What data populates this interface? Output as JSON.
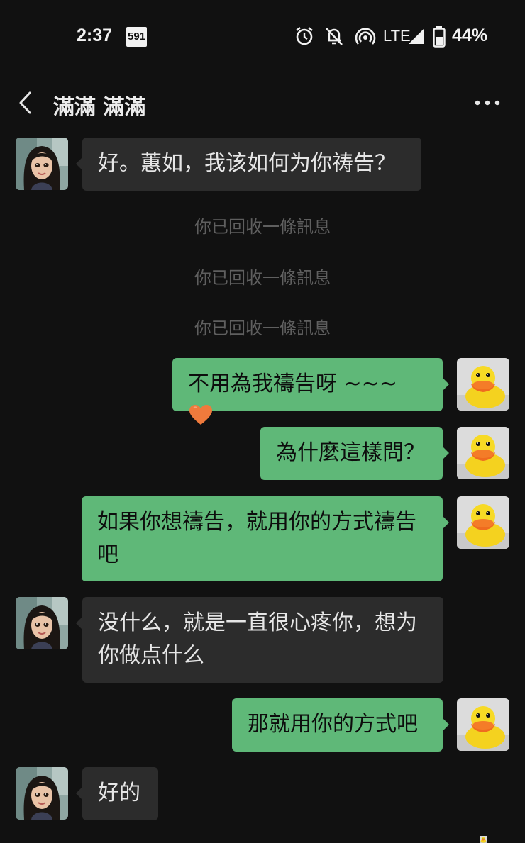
{
  "status_bar": {
    "time": "2:37",
    "badge": "591",
    "network": "LTE",
    "battery": "44%",
    "icons": [
      "alarm-icon",
      "notifications-off-icon",
      "hotspot-icon",
      "signal-icon",
      "battery-icon"
    ]
  },
  "header": {
    "title": "滿滿 滿滿",
    "back_icon": "chevron-left-icon",
    "more_icon": "more-horizontal-icon"
  },
  "messages": [
    {
      "from": "contact",
      "text": "好。蕙如，我该如何为你祷告？"
    },
    {
      "system": "你已回收一條訊息"
    },
    {
      "system": "你已回收一條訊息"
    },
    {
      "system": "你已回收一條訊息"
    },
    {
      "from": "me",
      "text": "不用為我禱告呀 ~~~",
      "emoji": "orange-heart-icon"
    },
    {
      "from": "me",
      "text": "為什麼這樣問？"
    },
    {
      "from": "me",
      "text_line1": "如果你想禱告，就用你的方式禱告",
      "text_line2": "吧"
    },
    {
      "from": "contact",
      "text_line1": "没什么，就是一直很心疼你，想为",
      "text_line2": "你做点什么"
    },
    {
      "from": "me",
      "text": "那就用你的方式吧"
    },
    {
      "from": "contact",
      "text": "好的"
    }
  ],
  "colors": {
    "background": "#111111",
    "incoming_bubble": "#2c2c2c",
    "outgoing_bubble": "#5fb878",
    "system_text": "#5f5f5f"
  }
}
